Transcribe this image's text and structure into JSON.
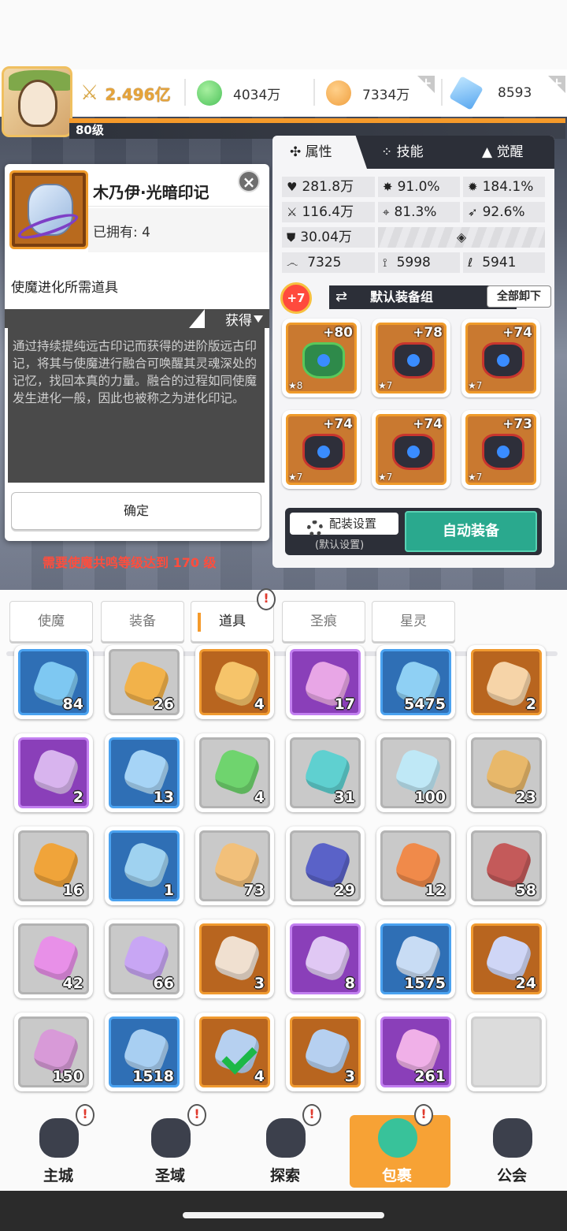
{
  "resources": {
    "power": "2.496亿",
    "green_gem": "4034万",
    "gold": "7334万",
    "crystal": "8593"
  },
  "player": {
    "level": "80级"
  },
  "dialog": {
    "item_name": "木乃伊·光暗印记",
    "owned": "已拥有: 4",
    "requirement": "使魔进化所需道具",
    "obtain": "获得",
    "description": "通过持续提纯远古印记而获得的进阶版远古印记，将其与使魔进行融合可唤醒其灵魂深处的记忆，找回本真的力量。融合的过程如同使魔发生进化一般，因此也被称之为进化印记。",
    "confirm": "确定",
    "close_icon": "close-icon"
  },
  "warning": "需要使魔共鸣等级达到 170 级",
  "panel": {
    "tabs": [
      "属性",
      "技能",
      "觉醒"
    ],
    "stats": {
      "hp": "281.8万",
      "crit": "91.0%",
      "crit_dmg": "184.1%",
      "atk": "116.4万",
      "hit": "81.3%",
      "dodge": "92.6%",
      "def": "30.04万",
      "s1": "7325",
      "s2": "5998",
      "s3": "5941"
    },
    "equip_level_badge": "+7",
    "equip_set": "默认装备组",
    "unload_all": "全部卸下",
    "equipment": [
      {
        "plus": "+80",
        "stars": "★8",
        "color": "#2e8a4a"
      },
      {
        "plus": "+78",
        "stars": "★7",
        "color": "#2e2f3a"
      },
      {
        "plus": "+74",
        "stars": "★7",
        "color": "#2e2f3a"
      },
      {
        "plus": "+74",
        "stars": "★7",
        "color": "#2e2f3a"
      },
      {
        "plus": "+74",
        "stars": "★7",
        "color": "#2e2f3a"
      },
      {
        "plus": "+73",
        "stars": "★7",
        "color": "#2e2f3a"
      }
    ],
    "config": "配装设置",
    "config_sub": "(默认设置)",
    "auto_equip": "自动装备"
  },
  "inventory_tabs": [
    "使魔",
    "装备",
    "道具",
    "圣痕",
    "星灵"
  ],
  "inventory_active_tab": "道具",
  "items": [
    {
      "count": "84",
      "rarity": "blue",
      "color": "#7ec8f2"
    },
    {
      "count": "26",
      "rarity": "gray",
      "color": "#f2b24a"
    },
    {
      "count": "4",
      "rarity": "orange",
      "color": "#f6c46a"
    },
    {
      "count": "17",
      "rarity": "purple",
      "color": "#e8a6e6"
    },
    {
      "count": "5475",
      "rarity": "blue",
      "color": "#8fd0f4"
    },
    {
      "count": "2",
      "rarity": "orange",
      "color": "#f6d4a8"
    },
    {
      "count": "2",
      "rarity": "purple",
      "color": "#d8b4ee"
    },
    {
      "count": "13",
      "rarity": "blue",
      "color": "#a6d4f6"
    },
    {
      "count": "4",
      "rarity": "gray",
      "color": "#6fd46e"
    },
    {
      "count": "31",
      "rarity": "gray",
      "color": "#5fd0d0"
    },
    {
      "count": "100",
      "rarity": "gray",
      "color": "#bfe8f6"
    },
    {
      "count": "23",
      "rarity": "gray",
      "color": "#e8b86a"
    },
    {
      "count": "16",
      "rarity": "gray",
      "color": "#f0a43a"
    },
    {
      "count": "1",
      "rarity": "blue",
      "color": "#9fd2f0"
    },
    {
      "count": "73",
      "rarity": "gray",
      "color": "#f2c07a"
    },
    {
      "count": "29",
      "rarity": "gray",
      "color": "#5a62c8"
    },
    {
      "count": "12",
      "rarity": "gray",
      "color": "#f08a4a"
    },
    {
      "count": "58",
      "rarity": "gray",
      "color": "#c45a5a"
    },
    {
      "count": "42",
      "rarity": "gray",
      "color": "#e890e8"
    },
    {
      "count": "66",
      "rarity": "gray",
      "color": "#c8a6f4"
    },
    {
      "count": "3",
      "rarity": "orange",
      "color": "#f0e0d0"
    },
    {
      "count": "8",
      "rarity": "purple",
      "color": "#e0c8f4"
    },
    {
      "count": "1575",
      "rarity": "blue",
      "color": "#c8dcf4"
    },
    {
      "count": "24",
      "rarity": "orange",
      "color": "#cfd6f6"
    },
    {
      "count": "150",
      "rarity": "gray",
      "color": "#d89ad8"
    },
    {
      "count": "1518",
      "rarity": "blue",
      "color": "#a8cff2"
    },
    {
      "count": "4",
      "rarity": "orange",
      "color": "#b6d0f0",
      "checked": true
    },
    {
      "count": "3",
      "rarity": "orange",
      "color": "#b6d0f0"
    },
    {
      "count": "261",
      "rarity": "purple",
      "color": "#f0b0e8"
    },
    {
      "count": "",
      "rarity": "empty",
      "color": "#dcdcdc"
    }
  ],
  "nav": [
    "主城",
    "圣域",
    "探索",
    "包裹",
    "公会"
  ],
  "nav_active": "包裹"
}
